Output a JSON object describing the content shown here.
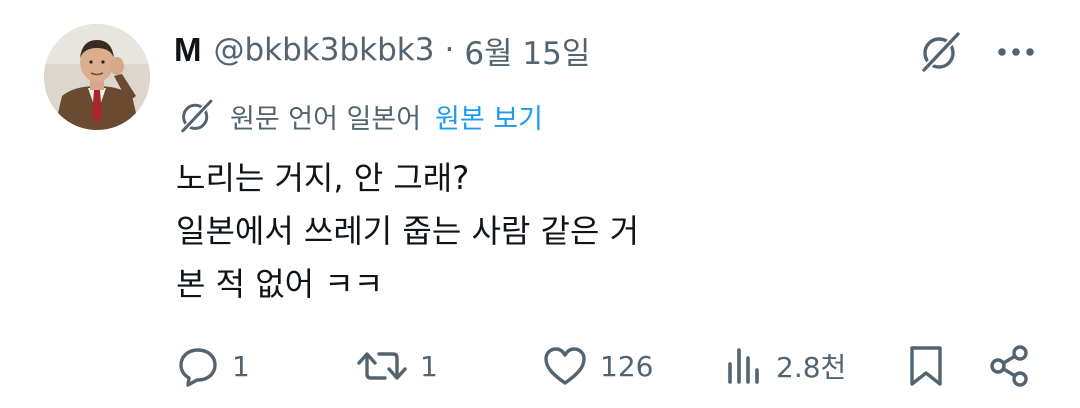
{
  "tweet": {
    "display_name": "M",
    "handle": "@bkbk3bkbk3",
    "separator": "·",
    "date": "6월 15일",
    "translation_note": "원문 언어 일본어",
    "translation_link": "원본 보기",
    "lines": [
      "노리는 거지, 안 그래?",
      "일본에서 쓰레기 줍는 사람 같은 거",
      "본 적 없어 ㅋㅋ"
    ]
  },
  "actions": {
    "reply_count": "1",
    "retweet_count": "1",
    "like_count": "126",
    "views_count": "2.8천"
  },
  "icons": {
    "grok": "grok-icon",
    "more": "more-icon",
    "translate": "grok-icon",
    "reply": "reply-icon",
    "retweet": "retweet-icon",
    "like": "heart-icon",
    "views": "views-icon",
    "bookmark": "bookmark-icon",
    "share": "share-icon"
  },
  "colors": {
    "text": "#0f1419",
    "secondary": "#536471",
    "link": "#1d9bf0"
  }
}
